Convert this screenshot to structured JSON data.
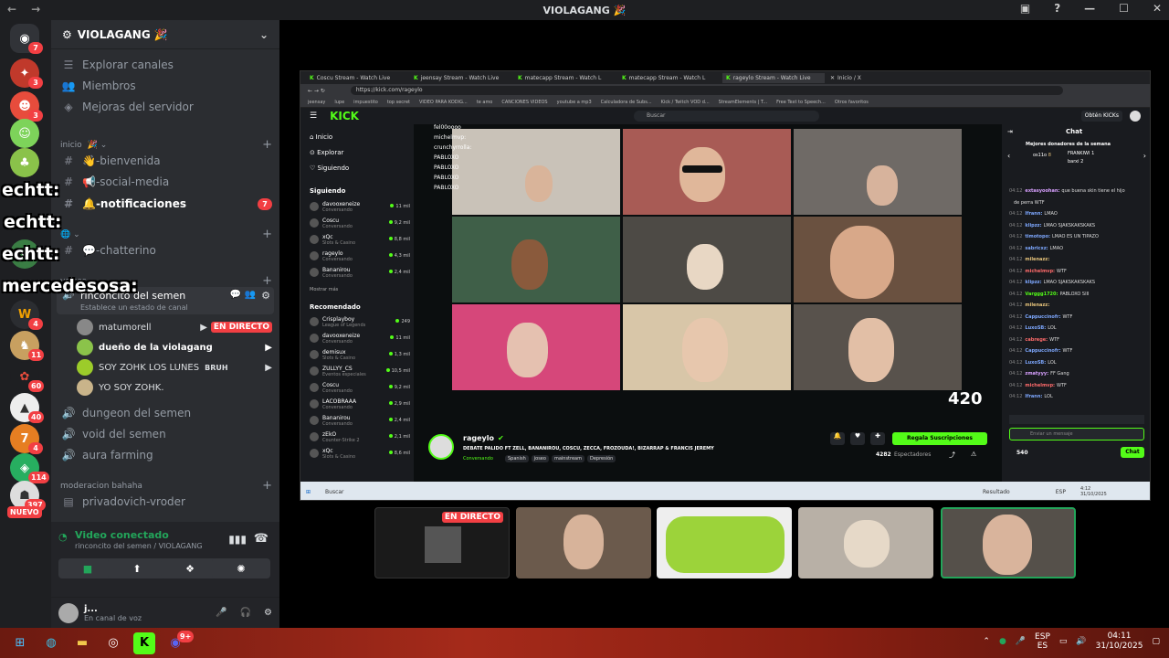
{
  "window": {
    "title": "VIOLAGANG",
    "title_emoji": "🎉"
  },
  "server": {
    "name": "VIOLAGANG",
    "emoji": "🎉"
  },
  "sidebar": {
    "top_items": [
      {
        "icon": "compass-icon",
        "label": "Explorar canales"
      },
      {
        "icon": "members-icon",
        "label": "Miembros"
      },
      {
        "icon": "boost-icon",
        "label": "Mejoras del servidor"
      }
    ],
    "category_inicio": "inicio",
    "channels": [
      {
        "label": "-bienvenida",
        "emoji": "👋"
      },
      {
        "label": "-social-media",
        "emoji": "📢"
      },
      {
        "label": "-notificaciones",
        "emoji": "🔔",
        "badge": "7"
      },
      {
        "label": "-chatterino",
        "emoji": "💬"
      }
    ],
    "category_voices": "voices",
    "voice_channel": {
      "name": "rinconcito del semen",
      "status": "Establece un estado de canal"
    },
    "voice_users": [
      {
        "name": "matumorell",
        "live": "EN DIRECTO"
      },
      {
        "name": "dueño de la violagang"
      },
      {
        "name": "SOY ZOHK LOS LUNES",
        "tag": "BRUH"
      },
      {
        "name": "YO SOY ZOHK."
      }
    ],
    "voice_channels": [
      "dungeon del semen",
      "void del semen",
      "aura farming"
    ],
    "category_mod": "moderacion bahaha",
    "mod_channel": "privadovich-vroder"
  },
  "voice_connection": {
    "status": "Video conectado",
    "channel": "rinconcito del semen / VIOLAGANG"
  },
  "user_panel": {
    "name": "j...",
    "status": "En canal de voz"
  },
  "rail": {
    "home_badge": "7",
    "badges": [
      "3",
      "3",
      "1",
      "4",
      "11",
      "60",
      "40",
      "4",
      "114",
      "397"
    ],
    "new_label": "NUEVO"
  },
  "overlay_names": [
    "echtt:",
    "echtt:",
    "echtt:",
    "mercedesosa:"
  ],
  "browser": {
    "tabs": [
      "Coscu Stream - Watch Live",
      "jeensay Stream - Watch Live",
      "matecapp Stream - Watch L",
      "matecapp Stream - Watch L",
      "rageylo Stream - Watch Live",
      "Inicio / X"
    ],
    "url": "https://kick.com/rageylo",
    "bookmarks": [
      "jeensay",
      "lupe",
      "impuestito",
      "top secret",
      "VIDEO PARA KODIG...",
      "te amo",
      "CANCIONES VIDEOS",
      "youtube a mp3",
      "Calculadora de Subs...",
      "Kick / Twitch VOD d...",
      "StreamElements | T...",
      "Free Text to Speech...",
      "Otros favoritos"
    ]
  },
  "kick": {
    "logo": "KICK",
    "search_placeholder": "Buscar",
    "get_kicks": "Obtén KICKs",
    "nav": [
      "Inicio",
      "Explorar",
      "Siguiendo"
    ],
    "following_title": "Siguiendo",
    "following": [
      {
        "name": "davooxeneize",
        "sub": "Conversando",
        "count": "11 mil"
      },
      {
        "name": "Coscu",
        "sub": "Conversando",
        "count": "9,2 mil"
      },
      {
        "name": "xQc",
        "sub": "Slots & Casino",
        "count": "8,8 mil"
      },
      {
        "name": "rageylo",
        "sub": "Conversando",
        "count": "4,3 mil"
      },
      {
        "name": "Bananirou",
        "sub": "Conversando",
        "count": "2,4 mil"
      }
    ],
    "show_more": "Mostrar más",
    "recommended_title": "Recomendado",
    "recommended": [
      {
        "name": "Crisplayboy",
        "sub": "League of Legends",
        "count": "249"
      },
      {
        "name": "davooxeneize",
        "sub": "Conversando",
        "count": "11 mil"
      },
      {
        "name": "demisux",
        "sub": "Slots & Casino",
        "count": "1,3 mil"
      },
      {
        "name": "ZULLYY_CS",
        "sub": "Eventos especiales",
        "count": "10,5 mil"
      },
      {
        "name": "Coscu",
        "sub": "Conversando",
        "count": "9,2 mil"
      },
      {
        "name": "LACOBRAAA",
        "sub": "Conversando",
        "count": "2,9 mil"
      },
      {
        "name": "Bananirou",
        "sub": "Conversando",
        "count": "2,4 mil"
      },
      {
        "name": "zEkO",
        "sub": "Counter-Strike 2",
        "count": "2,1 mil"
      },
      {
        "name": "xQc",
        "sub": "Slots & Casino",
        "count": "8,6 mil"
      }
    ],
    "video_chat_names": [
      "fel00oooo",
      "michelmvp:",
      "crunchyrrolla:",
      "PABLOXO",
      "PABLOXO",
      "PABLOXO",
      "PABLOXO"
    ],
    "video_logo": "420",
    "streamer": {
      "name": "rageylo",
      "title": "DEBATE PALIDO FT ZELL, BANANIROU, COSCU, ZECCA, FROZOUDA!, BIZARRAP & FRANCIS JEREMY",
      "category": "Conversando",
      "tags": [
        "Spanish",
        "joseo",
        "mainstream",
        "Depresión"
      ],
      "subscribe_label": "Regala Suscripciones",
      "viewers": "4282",
      "viewers_label": "Espectadores"
    },
    "chat": {
      "title": "Chat",
      "top_donors_title": "Mejores donadores de la semana",
      "donors": [
        {
          "name": "os11o",
          "amount": "8"
        },
        {
          "name": "FRANKIWI",
          "amount": "1"
        },
        {
          "name": "barxi",
          "amount": "2"
        }
      ],
      "messages": [
        {
          "time": "04:12",
          "user": "extasyoohan:",
          "text": "que buena skin tiene el hijo",
          "color": "#d8a0ff"
        },
        {
          "time": "",
          "user": "",
          "text": "de perra WTF",
          "color": "#d8a0ff"
        },
        {
          "time": "04:12",
          "user": "Ifrann:",
          "text": "LMAO",
          "color": "#7ea8ff"
        },
        {
          "time": "04:12",
          "user": "klipzz:",
          "text": "LMAO SJAKSKAKSKAKS",
          "color": "#7ea8ff"
        },
        {
          "time": "04:12",
          "user": "timotopo:",
          "text": "LMAO ES UN TIPAZO",
          "color": "#7ea8ff"
        },
        {
          "time": "04:12",
          "user": "sabricxz:",
          "text": "LMAO",
          "color": "#7ea8ff"
        },
        {
          "time": "04:12",
          "user": "milenazz:",
          "text": "",
          "color": "#e5c27a"
        },
        {
          "time": "04:12",
          "user": "michelmvp:",
          "text": "WTF",
          "color": "#ff6b6b"
        },
        {
          "time": "04:12",
          "user": "klipzz:",
          "text": "LMAO SJAKSKAKSKAKS",
          "color": "#7ea8ff"
        },
        {
          "time": "04:12",
          "user": "Varggg1720:",
          "text": "PABLOXO SIII",
          "color": "#53fc18"
        },
        {
          "time": "04:12",
          "user": "milenazz:",
          "text": "",
          "color": "#e5c27a"
        },
        {
          "time": "04:12",
          "user": "Cappuccinofr:",
          "text": "WTF",
          "color": "#7ea8ff"
        },
        {
          "time": "04:12",
          "user": "LuxoSB:",
          "text": "LOL",
          "color": "#7ea8ff"
        },
        {
          "time": "04:12",
          "user": "cabrege:",
          "text": "WTF",
          "color": "#ff6b6b"
        },
        {
          "time": "04:12",
          "user": "Cappuccinofr:",
          "text": "WTF",
          "color": "#7ea8ff"
        },
        {
          "time": "04:12",
          "user": "LuxoSB:",
          "text": "LOL",
          "color": "#7ea8ff"
        },
        {
          "time": "04:12",
          "user": "zmatyyy:",
          "text": "FF Gang",
          "color": "#d8a0ff"
        },
        {
          "time": "04:12",
          "user": "michelmvp:",
          "text": "WTF",
          "color": "#ff6b6b"
        },
        {
          "time": "04:12",
          "user": "Ifrann:",
          "text": "LOL",
          "color": "#7ea8ff"
        }
      ],
      "input_placeholder": "Enviar un mensaje",
      "kicks_count": "540",
      "send_label": "Chat"
    }
  },
  "inner_taskbar": {
    "search": "Buscar",
    "weather": "Resultado",
    "lang": "ESP",
    "time": "4:12",
    "date": "31/10/2025"
  },
  "screenshares": [
    {
      "label": "EN DIRECTO"
    },
    {},
    {},
    {},
    {}
  ],
  "taskbar": {
    "discord_badge": "9+",
    "lang1": "ESP",
    "lang2": "ES",
    "time": "04:11",
    "date": "31/10/2025"
  }
}
